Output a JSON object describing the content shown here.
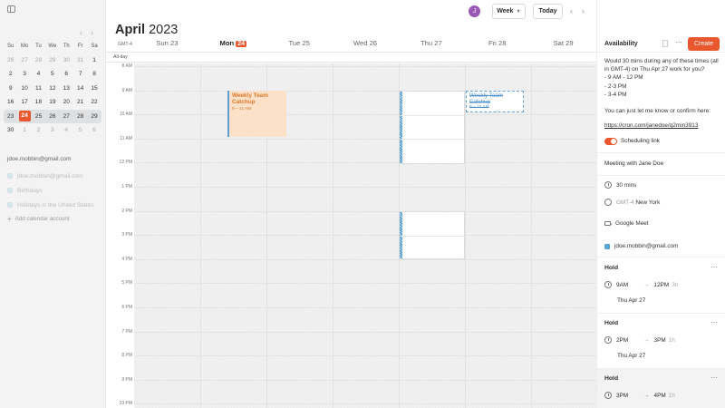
{
  "sidebar": {
    "mini_calendar": {
      "weekday_headers": [
        "Su",
        "Mo",
        "Tu",
        "We",
        "Th",
        "Fr",
        "Sa"
      ],
      "weeks": [
        [
          {
            "d": "26",
            "m": true
          },
          {
            "d": "27",
            "m": true
          },
          {
            "d": "28",
            "m": true
          },
          {
            "d": "29",
            "m": true
          },
          {
            "d": "30",
            "m": true
          },
          {
            "d": "31",
            "m": true
          },
          {
            "d": "1"
          }
        ],
        [
          {
            "d": "2"
          },
          {
            "d": "3"
          },
          {
            "d": "4"
          },
          {
            "d": "5"
          },
          {
            "d": "6"
          },
          {
            "d": "7"
          },
          {
            "d": "8"
          }
        ],
        [
          {
            "d": "9"
          },
          {
            "d": "10"
          },
          {
            "d": "11"
          },
          {
            "d": "12"
          },
          {
            "d": "13"
          },
          {
            "d": "14"
          },
          {
            "d": "15"
          }
        ],
        [
          {
            "d": "16"
          },
          {
            "d": "17"
          },
          {
            "d": "18"
          },
          {
            "d": "19"
          },
          {
            "d": "20"
          },
          {
            "d": "21"
          },
          {
            "d": "22"
          }
        ],
        [
          {
            "d": "23"
          },
          {
            "d": "24",
            "today": true
          },
          {
            "d": "25"
          },
          {
            "d": "26"
          },
          {
            "d": "27"
          },
          {
            "d": "28"
          },
          {
            "d": "29"
          }
        ],
        [
          {
            "d": "30"
          },
          {
            "d": "1",
            "m": true
          },
          {
            "d": "2",
            "m": true
          },
          {
            "d": "3",
            "m": true
          },
          {
            "d": "4",
            "m": true
          },
          {
            "d": "5",
            "m": true
          },
          {
            "d": "6",
            "m": true
          }
        ]
      ],
      "prev_label": "‹",
      "next_label": "›"
    },
    "account_email": "jdoe.mobbin@gmail.com",
    "calendars": [
      "jdoe.mobbin@gmail.com",
      "Birthdays",
      "Holidays in the United States"
    ],
    "add_calendar_label": "Add calendar account"
  },
  "header": {
    "month": "April",
    "year": "2023",
    "avatar_initial": "J",
    "view_label": "Week",
    "today_label": "Today",
    "prev_icon": "‹",
    "next_icon": "›",
    "timezone": "GMT-4",
    "all_day_label": "All-day"
  },
  "days": [
    {
      "name": "Sun",
      "num": "23",
      "today": false
    },
    {
      "name": "Mon",
      "num": "24",
      "today": true
    },
    {
      "name": "Tue",
      "num": "25",
      "today": false
    },
    {
      "name": "Wed",
      "num": "26",
      "today": false
    },
    {
      "name": "Thu",
      "num": "27",
      "today": false
    },
    {
      "name": "Fri",
      "num": "28",
      "today": false
    },
    {
      "name": "Sat",
      "num": "29",
      "today": false
    }
  ],
  "time_labels": [
    "8 AM",
    "9 AM",
    "10 AM",
    "11 AM",
    "12 PM",
    "1 PM",
    "2 PM",
    "3 PM",
    "4 PM",
    "5 PM",
    "6 PM",
    "7 PM",
    "8 PM",
    "9 PM",
    "10 PM"
  ],
  "events": {
    "catchup": {
      "title": "Weekly Team Catchup",
      "time": "9 – 11 AM"
    },
    "declined": {
      "title": "Weekly Team Catchup",
      "time": "9 – 10 AM"
    }
  },
  "panel": {
    "title": "Availability",
    "more_icon": "···",
    "create_label": "Create",
    "message": "Would 30 mins during any of these times (all in GMT-4) on Thu Apr 27 work for you?\n- 9 AM - 12 PM\n- 2-3 PM\n- 3-4 PM\n\nYou can just let me know or confirm here:",
    "link": "https://cron.com/janedoe/q2min3913",
    "scheduling_label": "Scheduling link",
    "meeting_title": "Meeting with Jane Doe",
    "duration": "30 mins",
    "tz_prefix": "GMT-4",
    "tz_city": "New York",
    "conference": "Google Meet",
    "calendar": "jdoe.mobbin@gmail.com",
    "holds": [
      {
        "label": "Hold",
        "start": "9AM",
        "end": "12PM",
        "dur": "3h",
        "date": "Thu Apr 27"
      },
      {
        "label": "Hold",
        "start": "2PM",
        "end": "3PM",
        "dur": "1h",
        "date": "Thu Apr 27"
      },
      {
        "label": "Hold",
        "start": "3PM",
        "end": "4PM",
        "dur": "1h",
        "date": "Thu Apr 27"
      }
    ]
  }
}
